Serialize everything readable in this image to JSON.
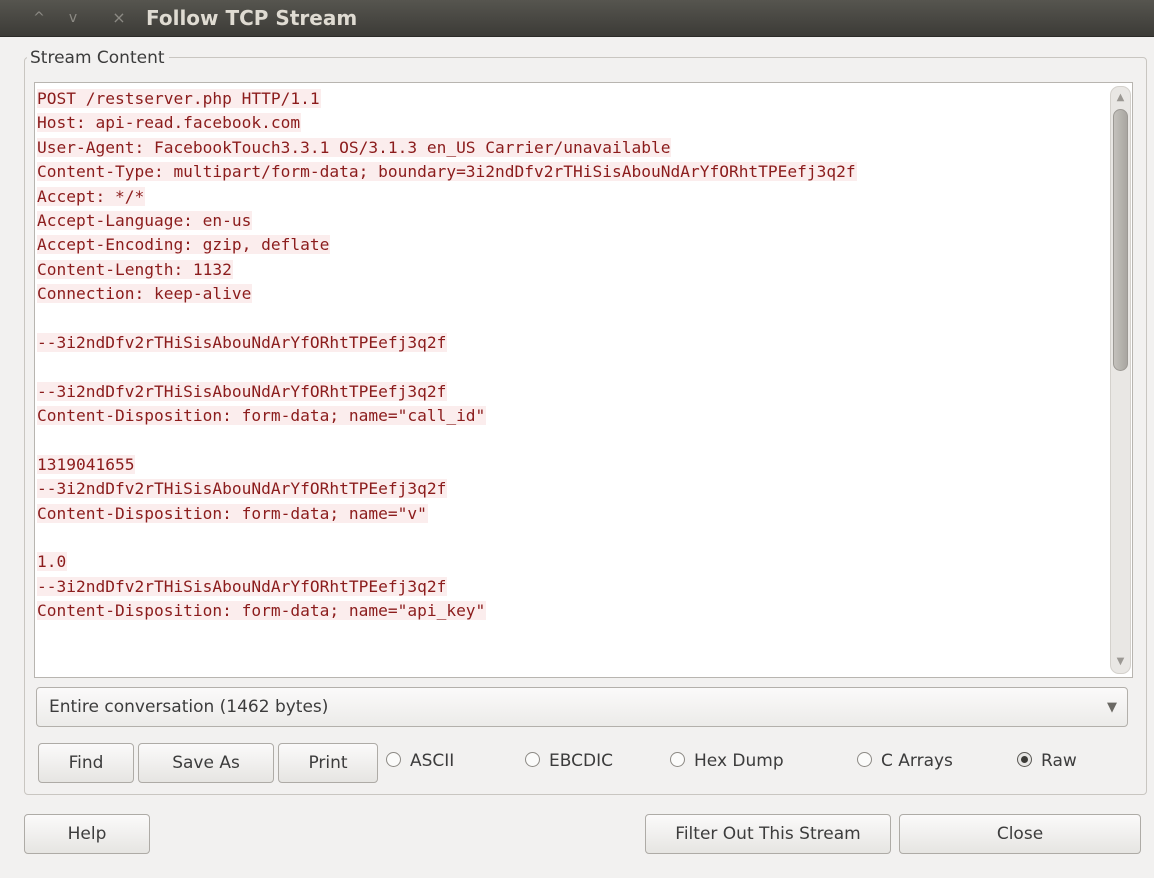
{
  "window": {
    "title": "Follow TCP Stream",
    "controls": {
      "minimize": "^",
      "maximize": "v",
      "close": "×"
    }
  },
  "stream_frame": {
    "label": "Stream Content",
    "lines": [
      "POST /restserver.php HTTP/1.1",
      "Host: api-read.facebook.com",
      "User-Agent: FacebookTouch3.3.1 OS/3.1.3 en_US Carrier/unavailable",
      "Content-Type: multipart/form-data; boundary=3i2ndDfv2rTHiSisAbouNdArYfORhtTPEefj3q2f",
      "Accept: */*",
      "Accept-Language: en-us",
      "Accept-Encoding: gzip, deflate",
      "Content-Length: 1132",
      "Connection: keep-alive",
      "",
      "--3i2ndDfv2rTHiSisAbouNdArYfORhtTPEefj3q2f",
      "",
      "--3i2ndDfv2rTHiSisAbouNdArYfORhtTPEefj3q2f",
      "Content-Disposition: form-data; name=\"call_id\"",
      "",
      "1319041655",
      "--3i2ndDfv2rTHiSisAbouNdArYfORhtTPEefj3q2f",
      "Content-Disposition: form-data; name=\"v\"",
      "",
      "1.0",
      "--3i2ndDfv2rTHiSisAbouNdArYfORhtTPEefj3q2f",
      "Content-Disposition: form-data; name=\"api_key\""
    ]
  },
  "conversation_select": {
    "value": "Entire conversation (1462 bytes)",
    "arrow": "▼"
  },
  "actions": {
    "find": "Find",
    "save_as": "Save As",
    "print": "Print"
  },
  "formats": [
    {
      "label": "ASCII",
      "checked": false
    },
    {
      "label": "EBCDIC",
      "checked": false
    },
    {
      "label": "Hex Dump",
      "checked": false
    },
    {
      "label": "C Arrays",
      "checked": false
    },
    {
      "label": "Raw",
      "checked": true
    }
  ],
  "footer": {
    "help": "Help",
    "filter_out": "Filter Out This Stream",
    "close": "Close"
  },
  "colors": {
    "stream_text": "#8b1c1c",
    "stream_highlight": "#fbeded",
    "titlebar": "#3c3b37"
  }
}
